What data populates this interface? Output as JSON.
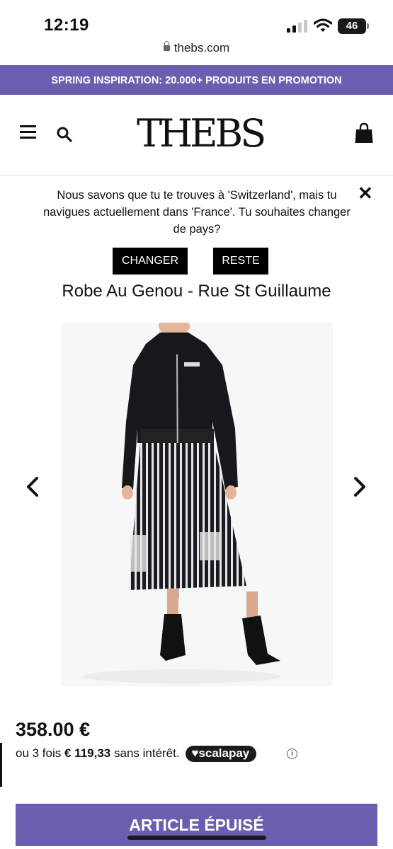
{
  "status_bar": {
    "time": "12:19",
    "battery": "46"
  },
  "browser": {
    "url": "thebs.com"
  },
  "promo": {
    "text": "SPRING INSPIRATION: 20.000+ PRODUITS EN PROMOTION"
  },
  "header": {
    "logo": "THEBS"
  },
  "country_notice": {
    "message": "Nous savons que tu te trouves à 'Switzerland', mais tu navigues actuellement dans 'France'. Tu souhaites changer de pays?",
    "change_label": "CHANGER",
    "stay_label": "RESTE"
  },
  "product": {
    "title": "Robe Au Genou - Rue St Guillaume",
    "price": "358.00 €",
    "installment_prefix": "ou 3 fois",
    "installment_amount": "€ 119,33",
    "installment_suffix": "sans intérêt.",
    "scalapay_label": "scalapay",
    "sold_out_label": "ARTICLE ÉPUISÉ"
  },
  "icons": {
    "menu": "menu-icon",
    "search": "search-icon",
    "bag": "shopping-bag-icon",
    "close": "close-icon",
    "prev": "chevron-left-icon",
    "next": "chevron-right-icon",
    "info": "info-icon"
  },
  "colors": {
    "brand": "#6b5eb0",
    "button_dark": "#000000"
  }
}
